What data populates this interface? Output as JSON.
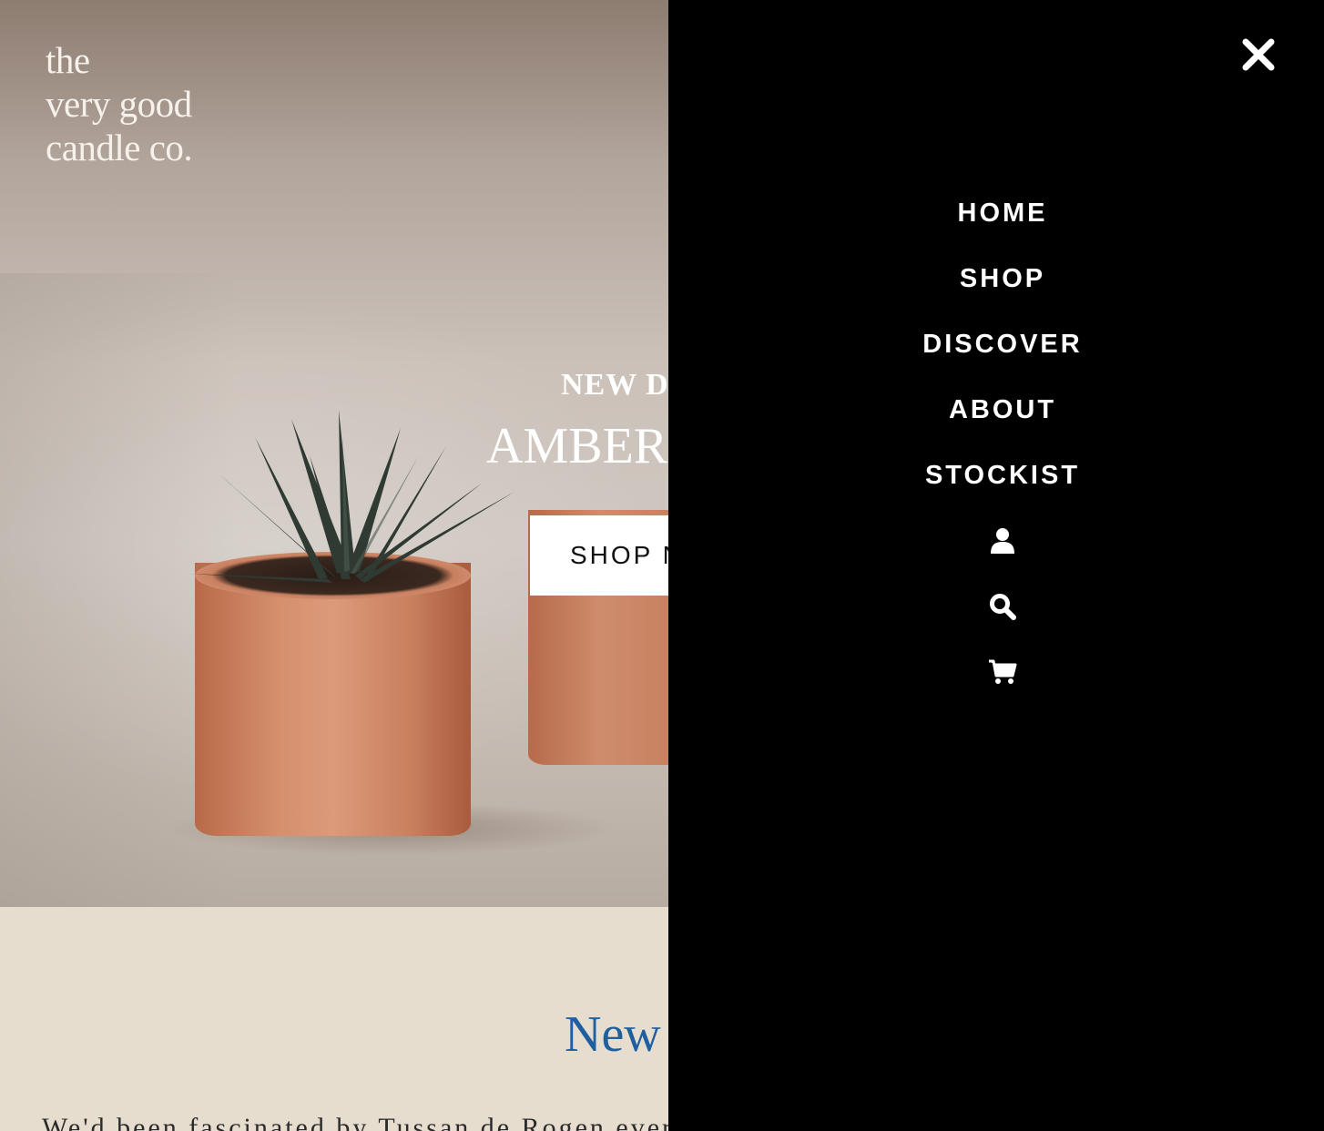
{
  "brand": {
    "logo_lines": [
      "the",
      "very good",
      "candle co."
    ]
  },
  "hero": {
    "eyebrow": "NEW D",
    "title": "AMBER C",
    "cta_label": "SHOP N"
  },
  "section": {
    "heading": "New",
    "body": "We'd been fascinated by Tussan de Rogen ever"
  },
  "drawer": {
    "close_icon": "close-icon",
    "nav_items": [
      "HOME",
      "SHOP",
      "DISCOVER",
      "ABOUT",
      "STOCKIST"
    ],
    "icons": [
      "user-icon",
      "search-icon",
      "cart-icon"
    ]
  },
  "colors": {
    "drawer_bg": "#000000",
    "section_bg": "#e6ddcf",
    "heading_blue": "#1f5fa0",
    "text_white": "#ffffff"
  }
}
